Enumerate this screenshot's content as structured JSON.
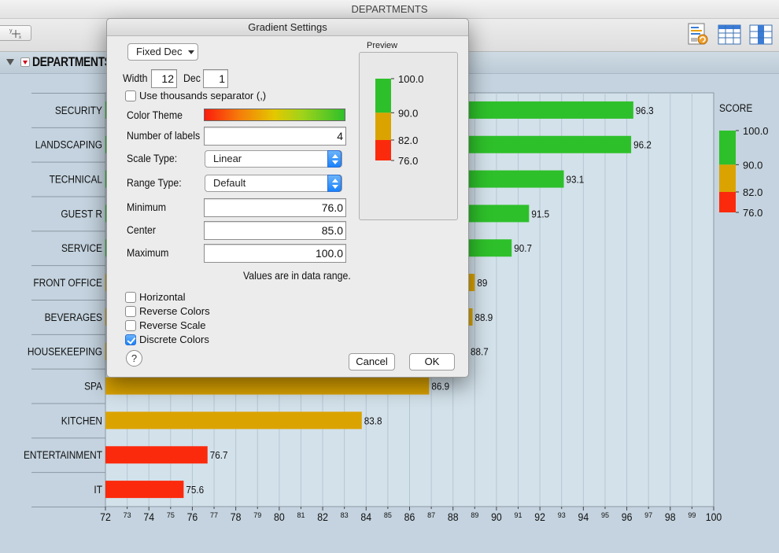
{
  "window": {
    "title": "DEPARTMENTS"
  },
  "section": {
    "title": "DEPARTMENTS d"
  },
  "toolbar": {
    "icons": [
      "report-icon",
      "table-icon",
      "column-icon"
    ]
  },
  "dialog": {
    "title": "Gradient Settings",
    "format_popup": "Fixed Dec",
    "width_label": "Width",
    "width_value": "12",
    "dec_label": "Dec",
    "dec_value": "1",
    "thousands_label": "Use thousands separator (,)",
    "thousands_checked": false,
    "color_theme_label": "Color Theme",
    "num_labels_label": "Number of labels",
    "num_labels_value": "4",
    "scale_type_label": "Scale Type:",
    "scale_type_value": "Linear",
    "range_type_label": "Range Type:",
    "range_type_value": "Default",
    "minimum_label": "Minimum",
    "minimum_value": "76.0",
    "center_label": "Center",
    "center_value": "85.0",
    "maximum_label": "Maximum",
    "maximum_value": "100.0",
    "range_note": "Values are in data range.",
    "checkboxes": [
      {
        "label": "Horizontal",
        "checked": false
      },
      {
        "label": "Reverse Colors",
        "checked": false
      },
      {
        "label": "Reverse Scale",
        "checked": false
      },
      {
        "label": "Discrete Colors",
        "checked": true
      }
    ],
    "help_label": "?",
    "cancel_label": "Cancel",
    "ok_label": "OK",
    "preview_label": "Preview",
    "preview_labels": [
      "100.0",
      "90.0",
      "82.0",
      "76.0"
    ]
  },
  "colors": {
    "green": "#2ec02a",
    "gold": "#dba300",
    "red": "#fc2a0c",
    "plot_bg": "#d3e1ea"
  },
  "chart_data": {
    "type": "bar",
    "orientation": "horizontal",
    "categories": [
      "SECURITY",
      "LANDSCAPING",
      "TECHNICAL",
      "GUEST R",
      "SERVICE",
      "FRONT OFFICE",
      "BEVERAGES",
      "HOUSEKEEPING",
      "SPA",
      "KITCHEN",
      "ENTERTAINMENT",
      "IT"
    ],
    "values": [
      96.3,
      96.2,
      93.1,
      91.5,
      90.7,
      89,
      88.9,
      88.7,
      86.9,
      83.8,
      76.7,
      75.6
    ],
    "value_labels": [
      "96.3",
      "96.2",
      "93.1",
      "91.5",
      "90.7",
      "89",
      "88.9",
      "88.7",
      "86.9",
      "83.8",
      "76.7",
      "75.6"
    ],
    "xlim": [
      72,
      100
    ],
    "x_ticks_major": [
      "72",
      "74",
      "76",
      "78",
      "80",
      "82",
      "84",
      "86",
      "88",
      "90",
      "92",
      "94",
      "96",
      "98",
      "100"
    ],
    "x_ticks_minor": [
      "73",
      "75",
      "77",
      "79",
      "81",
      "83",
      "85",
      "87",
      "89",
      "91",
      "93",
      "95",
      "97",
      "99"
    ],
    "legend": {
      "title": "SCORE",
      "labels": [
        "100.0",
        "90.0",
        "82.0",
        "76.0"
      ],
      "bands": [
        {
          "from": 90,
          "to": 100,
          "color": "#2ec02a"
        },
        {
          "from": 82,
          "to": 90,
          "color": "#dba300"
        },
        {
          "from": 76,
          "to": 82,
          "color": "#fc2a0c"
        }
      ],
      "placement": "right"
    },
    "grid": true
  }
}
